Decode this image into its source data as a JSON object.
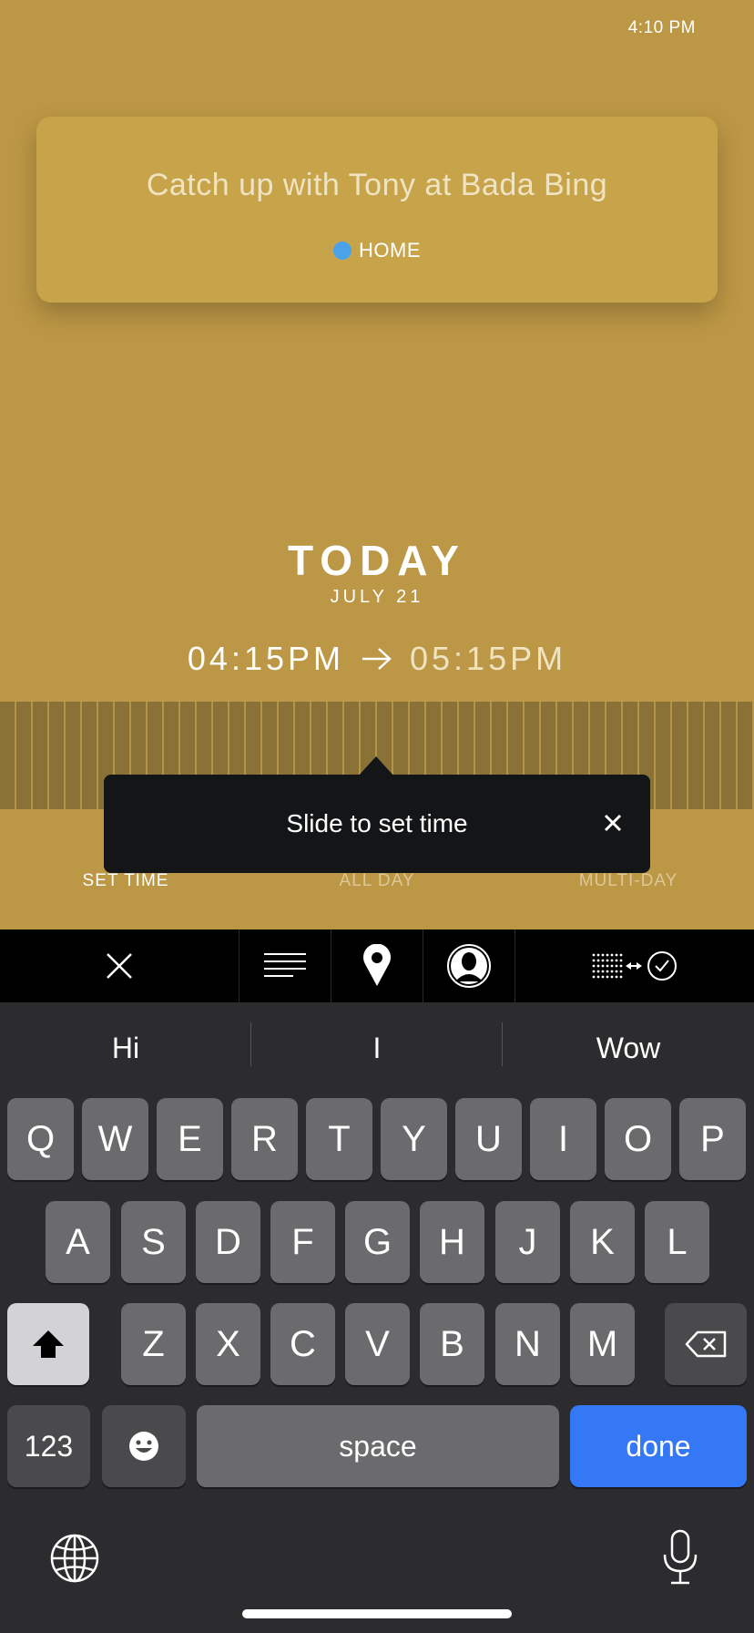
{
  "status": {
    "time": "4:10 PM"
  },
  "event": {
    "title": "Catch up with Tony at Bada Bing",
    "calendar": "HOME",
    "calendar_color": "#4aa3e9"
  },
  "schedule": {
    "day": "TODAY",
    "date": "JULY 21",
    "start": "04:15PM",
    "end": "05:15PM"
  },
  "tooltip": {
    "text": "Slide to set time"
  },
  "modes": {
    "set_time": "SET TIME",
    "all_day": "ALL DAY",
    "multi_day": "MULTI-DAY"
  },
  "toolbar": {
    "icons": [
      "close-icon",
      "notes-icon",
      "location-pin-icon",
      "person-icon",
      "date-range-confirm-icon"
    ]
  },
  "keyboard": {
    "suggestions": [
      "Hi",
      "I",
      "Wow"
    ],
    "row1": [
      "Q",
      "W",
      "E",
      "R",
      "T",
      "Y",
      "U",
      "I",
      "O",
      "P"
    ],
    "row2": [
      "A",
      "S",
      "D",
      "F",
      "G",
      "H",
      "J",
      "K",
      "L"
    ],
    "row3": [
      "Z",
      "X",
      "C",
      "V",
      "B",
      "N",
      "M"
    ],
    "numbers_label": "123",
    "space_label": "space",
    "done_label": "done"
  },
  "colors": {
    "background": "#bc9745",
    "card": "#c7a44a",
    "tooltip": "#141517",
    "done_key": "#3478f6"
  }
}
